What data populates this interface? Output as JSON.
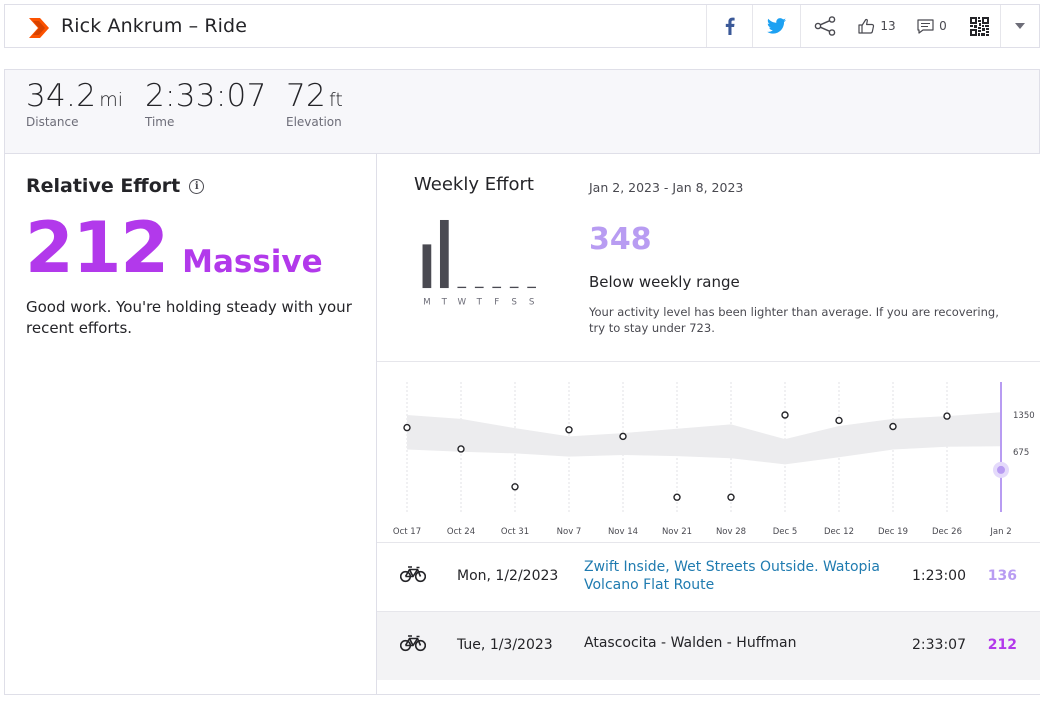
{
  "header": {
    "title": "Rick Ankrum – Ride",
    "kudos_count": "13",
    "comments_count": "0",
    "icons": [
      "strava-logo-icon",
      "facebook-icon",
      "twitter-icon",
      "share-icon",
      "thumbs-up-icon",
      "comment-icon",
      "qr-code-icon",
      "chevron-down-icon"
    ]
  },
  "stats": [
    {
      "value": "34.2",
      "unit": "mi",
      "label": "Distance"
    },
    {
      "value": "2:33:07",
      "unit": "",
      "label": "Time"
    },
    {
      "value": "72",
      "unit": "ft",
      "label": "Elevation"
    }
  ],
  "relative_effort": {
    "title": "Relative Effort",
    "score": "212",
    "level": "Massive",
    "description": "Good work. You're holding steady with your recent efforts.",
    "color": "#b239eb"
  },
  "weekly_effort": {
    "title": "Weekly Effort",
    "date_range": "Jan 2, 2023 - Jan 8, 2023",
    "score": "348",
    "status": "Below weekly range",
    "description": "Your activity level has been lighter than average. If you are recovering, try to stay under 723.",
    "score_color": "#b89cf2",
    "days": [
      "M",
      "T",
      "W",
      "T",
      "F",
      "S",
      "S"
    ],
    "day_values": [
      136,
      212,
      0,
      0,
      0,
      0,
      0
    ]
  },
  "chart_data": {
    "type": "line",
    "x": [
      "Oct 17",
      "Oct 24",
      "Oct 31",
      "Nov 7",
      "Nov 14",
      "Nov 21",
      "Nov 28",
      "Dec 5",
      "Dec 12",
      "Dec 19",
      "Dec 26",
      "Jan 2"
    ],
    "points": [
      1120,
      730,
      40,
      1080,
      960,
      -150,
      -150,
      1350,
      1250,
      1140,
      1330,
      348
    ],
    "range_upper": [
      1350,
      1280,
      1110,
      960,
      1020,
      1100,
      1180,
      910,
      1150,
      1280,
      1330,
      1400
    ],
    "range_lower": [
      720,
      680,
      650,
      590,
      620,
      600,
      560,
      450,
      580,
      720,
      770,
      780
    ],
    "y_ticks": [
      "1350",
      "675"
    ],
    "ylim": [
      -250,
      1850
    ]
  },
  "activities": [
    {
      "date": "Mon, 1/2/2023",
      "name": "Zwift Inside, Wet Streets Outside. Watopia Volcano Flat Route",
      "time": "1:23:00",
      "score": "136",
      "score_color": "#b89cf2",
      "icon": "bike-icon"
    },
    {
      "date": "Tue, 1/3/2023",
      "name": "Atascocita - Walden - Huffman",
      "time": "2:33:07",
      "score": "212",
      "score_color": "#b239eb",
      "icon": "bike-icon"
    }
  ]
}
